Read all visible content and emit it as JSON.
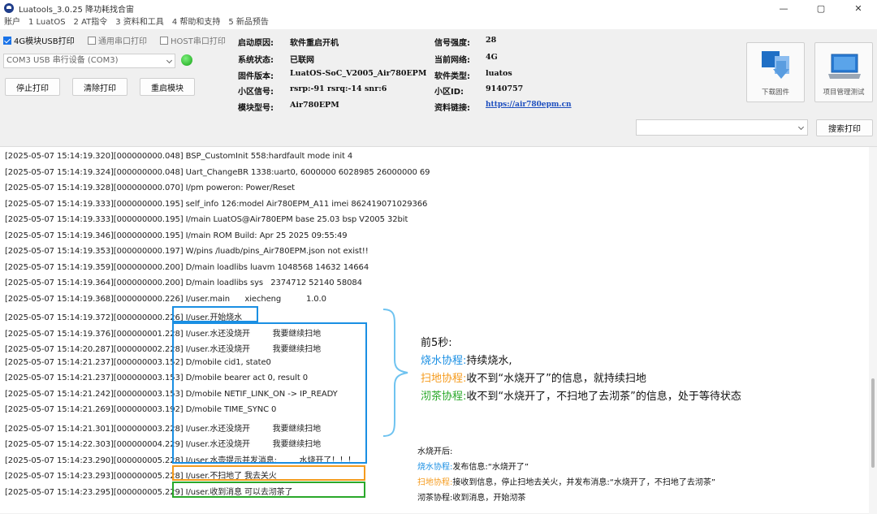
{
  "window": {
    "title": "Luatools_3.0.25 降功耗找合宙",
    "minimize": "—",
    "maximize": "▢",
    "close": "✕"
  },
  "menu": [
    "账户",
    "1 LuatOS",
    "2 AT指令",
    "3 资料和工具",
    "4 帮助和支持",
    "5 新品预告"
  ],
  "options": {
    "usb_print": "4G模块USB打印",
    "uart_print": "通用串口打印",
    "host_print": "HOST串口打印",
    "port": "COM3 USB 串行设备 (COM3)"
  },
  "buttons": {
    "stop": "停止打印",
    "clear": "清除打印",
    "restart": "重启模块",
    "search": "搜索打印"
  },
  "info": {
    "boot_reason_label": "启动原因:",
    "boot_reason": "软件重启开机",
    "sys_state_label": "系统状态:",
    "sys_state": "已联网",
    "firmware_label": "固件版本:",
    "firmware": "LuatOS-SoC_V2005_Air780EPM",
    "cell_signal_label": "小区信号:",
    "cell_signal": "rsrp:-91 rsrq:-14 snr:6",
    "model_label": "模块型号:",
    "model": "Air780EPM",
    "signal_label": "信号强度:",
    "signal": "28",
    "network_label": "当前网络:",
    "network": "4G",
    "software_label": "软件类型:",
    "software": "luatos",
    "cell_id_label": "小区ID:",
    "cell_id": "9140757",
    "docs_label": "资料链接:",
    "docs_link": "https://air780epm.cn"
  },
  "tools": {
    "download_firmware": "下载固件",
    "project_test": "项目管理测试"
  },
  "log": [
    "[2025-05-07 15:14:19.320][000000000.048] BSP_CustomInit 558:hardfault mode init 4",
    "[2025-05-07 15:14:19.324][000000000.048] Uart_ChangeBR 1338:uart0, 6000000 6028985 26000000 69",
    "[2025-05-07 15:14:19.328][000000000.070] I/pm poweron: Power/Reset",
    "[2025-05-07 15:14:19.333][000000000.195] self_info 126:model Air780EPM_A11 imei 862419071029366",
    "[2025-05-07 15:14:19.333][000000000.195] I/main LuatOS@Air780EPM base 25.03 bsp V2005 32bit",
    "[2025-05-07 15:14:19.346][000000000.195] I/main ROM Build: Apr 25 2025 09:55:49",
    "[2025-05-07 15:14:19.353][000000000.197] W/pins /luadb/pins_Air780EPM.json not exist!!",
    "[2025-05-07 15:14:19.359][000000000.200] D/main loadlibs luavm 1048568 14632 14664",
    "[2025-05-07 15:14:19.364][000000000.200] D/main loadlibs sys   2374712 52140 58084",
    "[2025-05-07 15:14:19.368][000000000.226] I/user.main      xiecheng          1.0.0",
    "[2025-05-07 15:14:19.372][000000000.226] I/user.开始烧水",
    "[2025-05-07 15:14:19.376][000000001.228] I/user.水还没烧开         我要继续扫地",
    "[2025-05-07 15:14:20.287][000000002.228] I/user.水还没烧开         我要继续扫地",
    "[2025-05-07 15:14:21.237][000000003.152] D/mobile cid1, state0",
    "[2025-05-07 15:14:21.237][000000003.153] D/mobile bearer act 0, result 0",
    "[2025-05-07 15:14:21.242][000000003.153] D/mobile NETIF_LINK_ON -> IP_READY",
    "[2025-05-07 15:14:21.269][000000003.192] D/mobile TIME_SYNC 0",
    "[2025-05-07 15:14:21.301][000000003.228] I/user.水还没烧开         我要继续扫地",
    "[2025-05-07 15:14:22.303][000000004.229] I/user.水还没烧开         我要继续扫地",
    "[2025-05-07 15:14:23.290][000000005.228] I/user.水壶提示并发消息:         水烧开了！！！",
    "[2025-05-07 15:14:23.293][000000005.228] I/user.不扫地了 我去关火",
    "[2025-05-07 15:14:23.295][000000005.229] I/user.收到消息 可以去沏茶了"
  ],
  "annotation1": {
    "heading": "前5秒:",
    "l1_name": "烧水协程:",
    "l1_text": "持续烧水,",
    "l2_name": "扫地协程:",
    "l2_text": "收不到“水烧开了”的信息，就持续扫地",
    "l3_name": "沏茶协程:",
    "l3_text": "收不到“水烧开了，不扫地了去沏茶”的信息，处于等待状态"
  },
  "annotation2": {
    "heading": "水烧开后:",
    "l1_name": "烧水协程:",
    "l1_text": "发布信息:“水烧开了”",
    "l2_name": "扫地协程:",
    "l2_text": "接收到信息，停止扫地去关火，并发布消息:“水烧开了，不扫地了去沏茶”",
    "l3_name": "沏茶协程:",
    "l3_text": "收到消息，开始沏茶"
  },
  "colors": {
    "blue": "#1a8fe3",
    "orange": "#f59b1d",
    "green": "#2aa82a"
  }
}
